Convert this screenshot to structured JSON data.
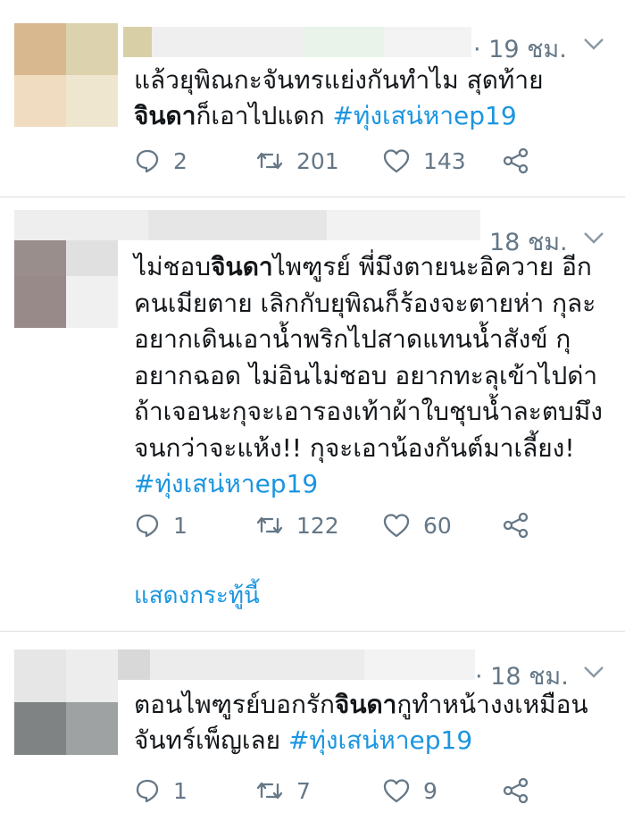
{
  "colors": {
    "link": "#1b95e0",
    "secondary_text": "#657786",
    "divider": "#dcdcdc"
  },
  "tweets": [
    {
      "time": "· 19 ชม.",
      "text_parts": [
        "แล้วยุพิณกะจันทรแย่งกันทำไม สุดท้าย ",
        "จินดา",
        "ก็เอาไปแดก ",
        "#ทุ่งเสน่หาep19"
      ],
      "replies": "2",
      "retweets": "201",
      "likes": "143"
    },
    {
      "time": "18 ชม.",
      "text_parts": [
        "ไม่ชอบ",
        "จินดา",
        "ไพฑูรย์ พี่มึงตายนะอิควาย อีกคนเมียตาย เลิกกับยุพิณก็ร้องจะตายห่า กุละอยากเดินเอาน้ำพริกไปสาดแทนน้ำสังข์ กุอยากฉอด ไม่อินไม่ชอบ อยากทะลุเข้าไปด่า ถ้าเจอนะกุจะเอารองเท้าผ้าใบชุบน้ำละตบมึงจนกว่าจะแห้ง!! กุจะเอาน้องกันต์มาเลี้ยง!",
        "#ทุ่งเสน่หาep19"
      ],
      "replies": "1",
      "retweets": "122",
      "likes": "60",
      "show_thread": "แสดงกระทู้นี้"
    },
    {
      "time": "· 18 ชม.",
      "text_parts": [
        "ตอนไพฑูรย์บอกรัก",
        "จินดา",
        "กูทำหน้างงเหมือนจันทร์เพ็ญเลย ",
        "#ทุ่งเสน่หาep19"
      ],
      "replies": "1",
      "retweets": "7",
      "likes": "9"
    }
  ],
  "icons": {
    "reply": "reply-icon",
    "retweet": "retweet-icon",
    "like": "heart-icon",
    "share": "share-icon",
    "menu": "chevron-down-icon"
  }
}
